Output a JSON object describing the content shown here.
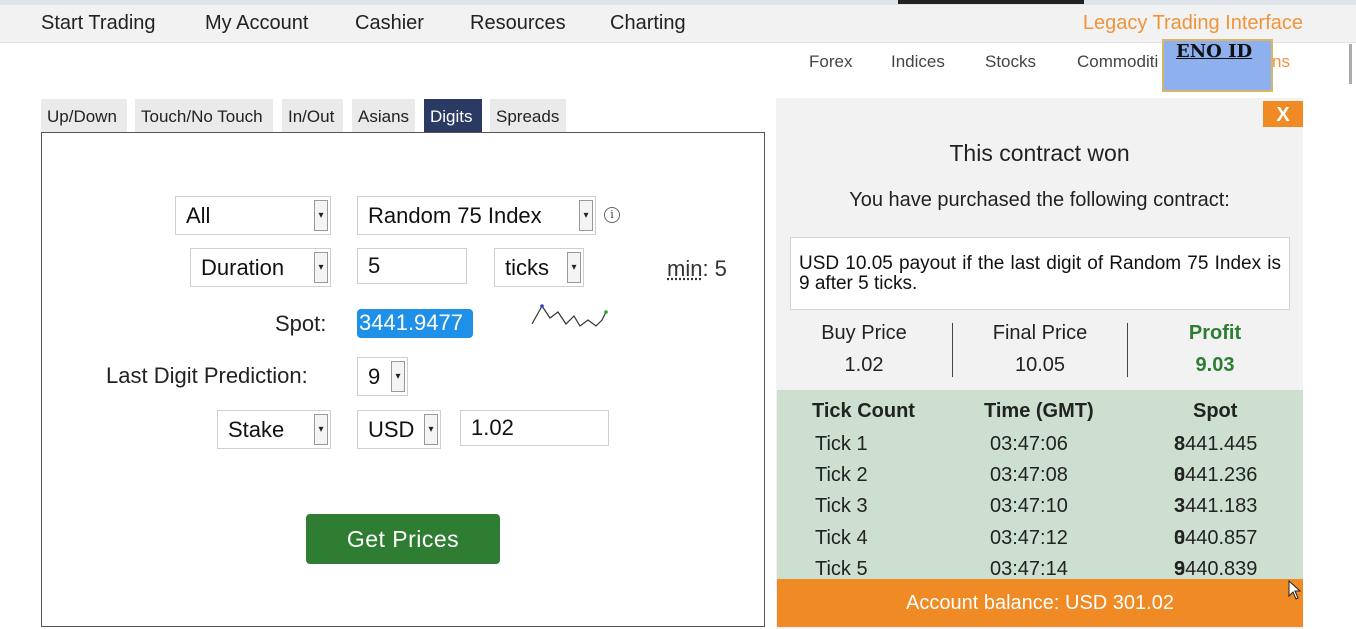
{
  "nav": {
    "items": [
      "Start Trading",
      "My Account",
      "Cashier",
      "Resources",
      "Charting"
    ],
    "legacy": "Legacy Trading Interface"
  },
  "subnav": {
    "items": [
      "Forex",
      "Indices",
      "Stocks",
      "Commoditi"
    ],
    "overflow": "ns"
  },
  "overlay": {
    "text": "ENO ID"
  },
  "tabs": [
    "Up/Down",
    "Touch/No Touch",
    "In/Out",
    "Asians",
    "Digits",
    "Spreads"
  ],
  "active_tab": "Digits",
  "form": {
    "market": "All",
    "underlying": "Random 75 Index",
    "duration_type": "Duration",
    "duration_value": "5",
    "duration_unit": "ticks",
    "min_label": "min",
    "min_value": ": 5",
    "spot_label": "Spot:",
    "spot_value": "3441.9477",
    "prediction_label": "Last Digit Prediction:",
    "prediction_value": "9",
    "amount_type": "Stake",
    "currency": "USD",
    "amount": "1.02",
    "get_prices": "Get Prices"
  },
  "result": {
    "close": "X",
    "title": "This contract won",
    "purchased": "You have purchased the following contract:",
    "description": "USD 10.05 payout if the last digit of Random 75 Index is 9 after 5 ticks.",
    "buy_price_label": "Buy Price",
    "buy_price": "1.02",
    "final_price_label": "Final Price",
    "final_price": "10.05",
    "profit_label": "Profit",
    "profit": "9.03",
    "ticks_headers": [
      "Tick Count",
      "Time (GMT)",
      "Spot"
    ],
    "ticks": [
      {
        "count": "Tick 1",
        "time": "03:47:06",
        "spot": "3441.445",
        "digit": "8"
      },
      {
        "count": "Tick 2",
        "time": "03:47:08",
        "spot": "3441.236",
        "digit": "0"
      },
      {
        "count": "Tick 3",
        "time": "03:47:10",
        "spot": "3441.183",
        "digit": "3"
      },
      {
        "count": "Tick 4",
        "time": "03:47:12",
        "spot": "3440.857",
        "digit": "0"
      },
      {
        "count": "Tick 5",
        "time": "03:47:14",
        "spot": "3440.839",
        "digit": "9"
      }
    ],
    "balance": "Account balance: USD 301.02"
  },
  "colors": {
    "accent_orange": "#f08a24",
    "active_tab": "#2a3a63",
    "button_green": "#2e7d32",
    "ticks_bg": "#cde0d0",
    "spot_highlight": "#1e90e8"
  },
  "icons": [
    "info-icon",
    "dropdown-arrow-icon",
    "sparkline-chart",
    "mouse-cursor-icon"
  ]
}
